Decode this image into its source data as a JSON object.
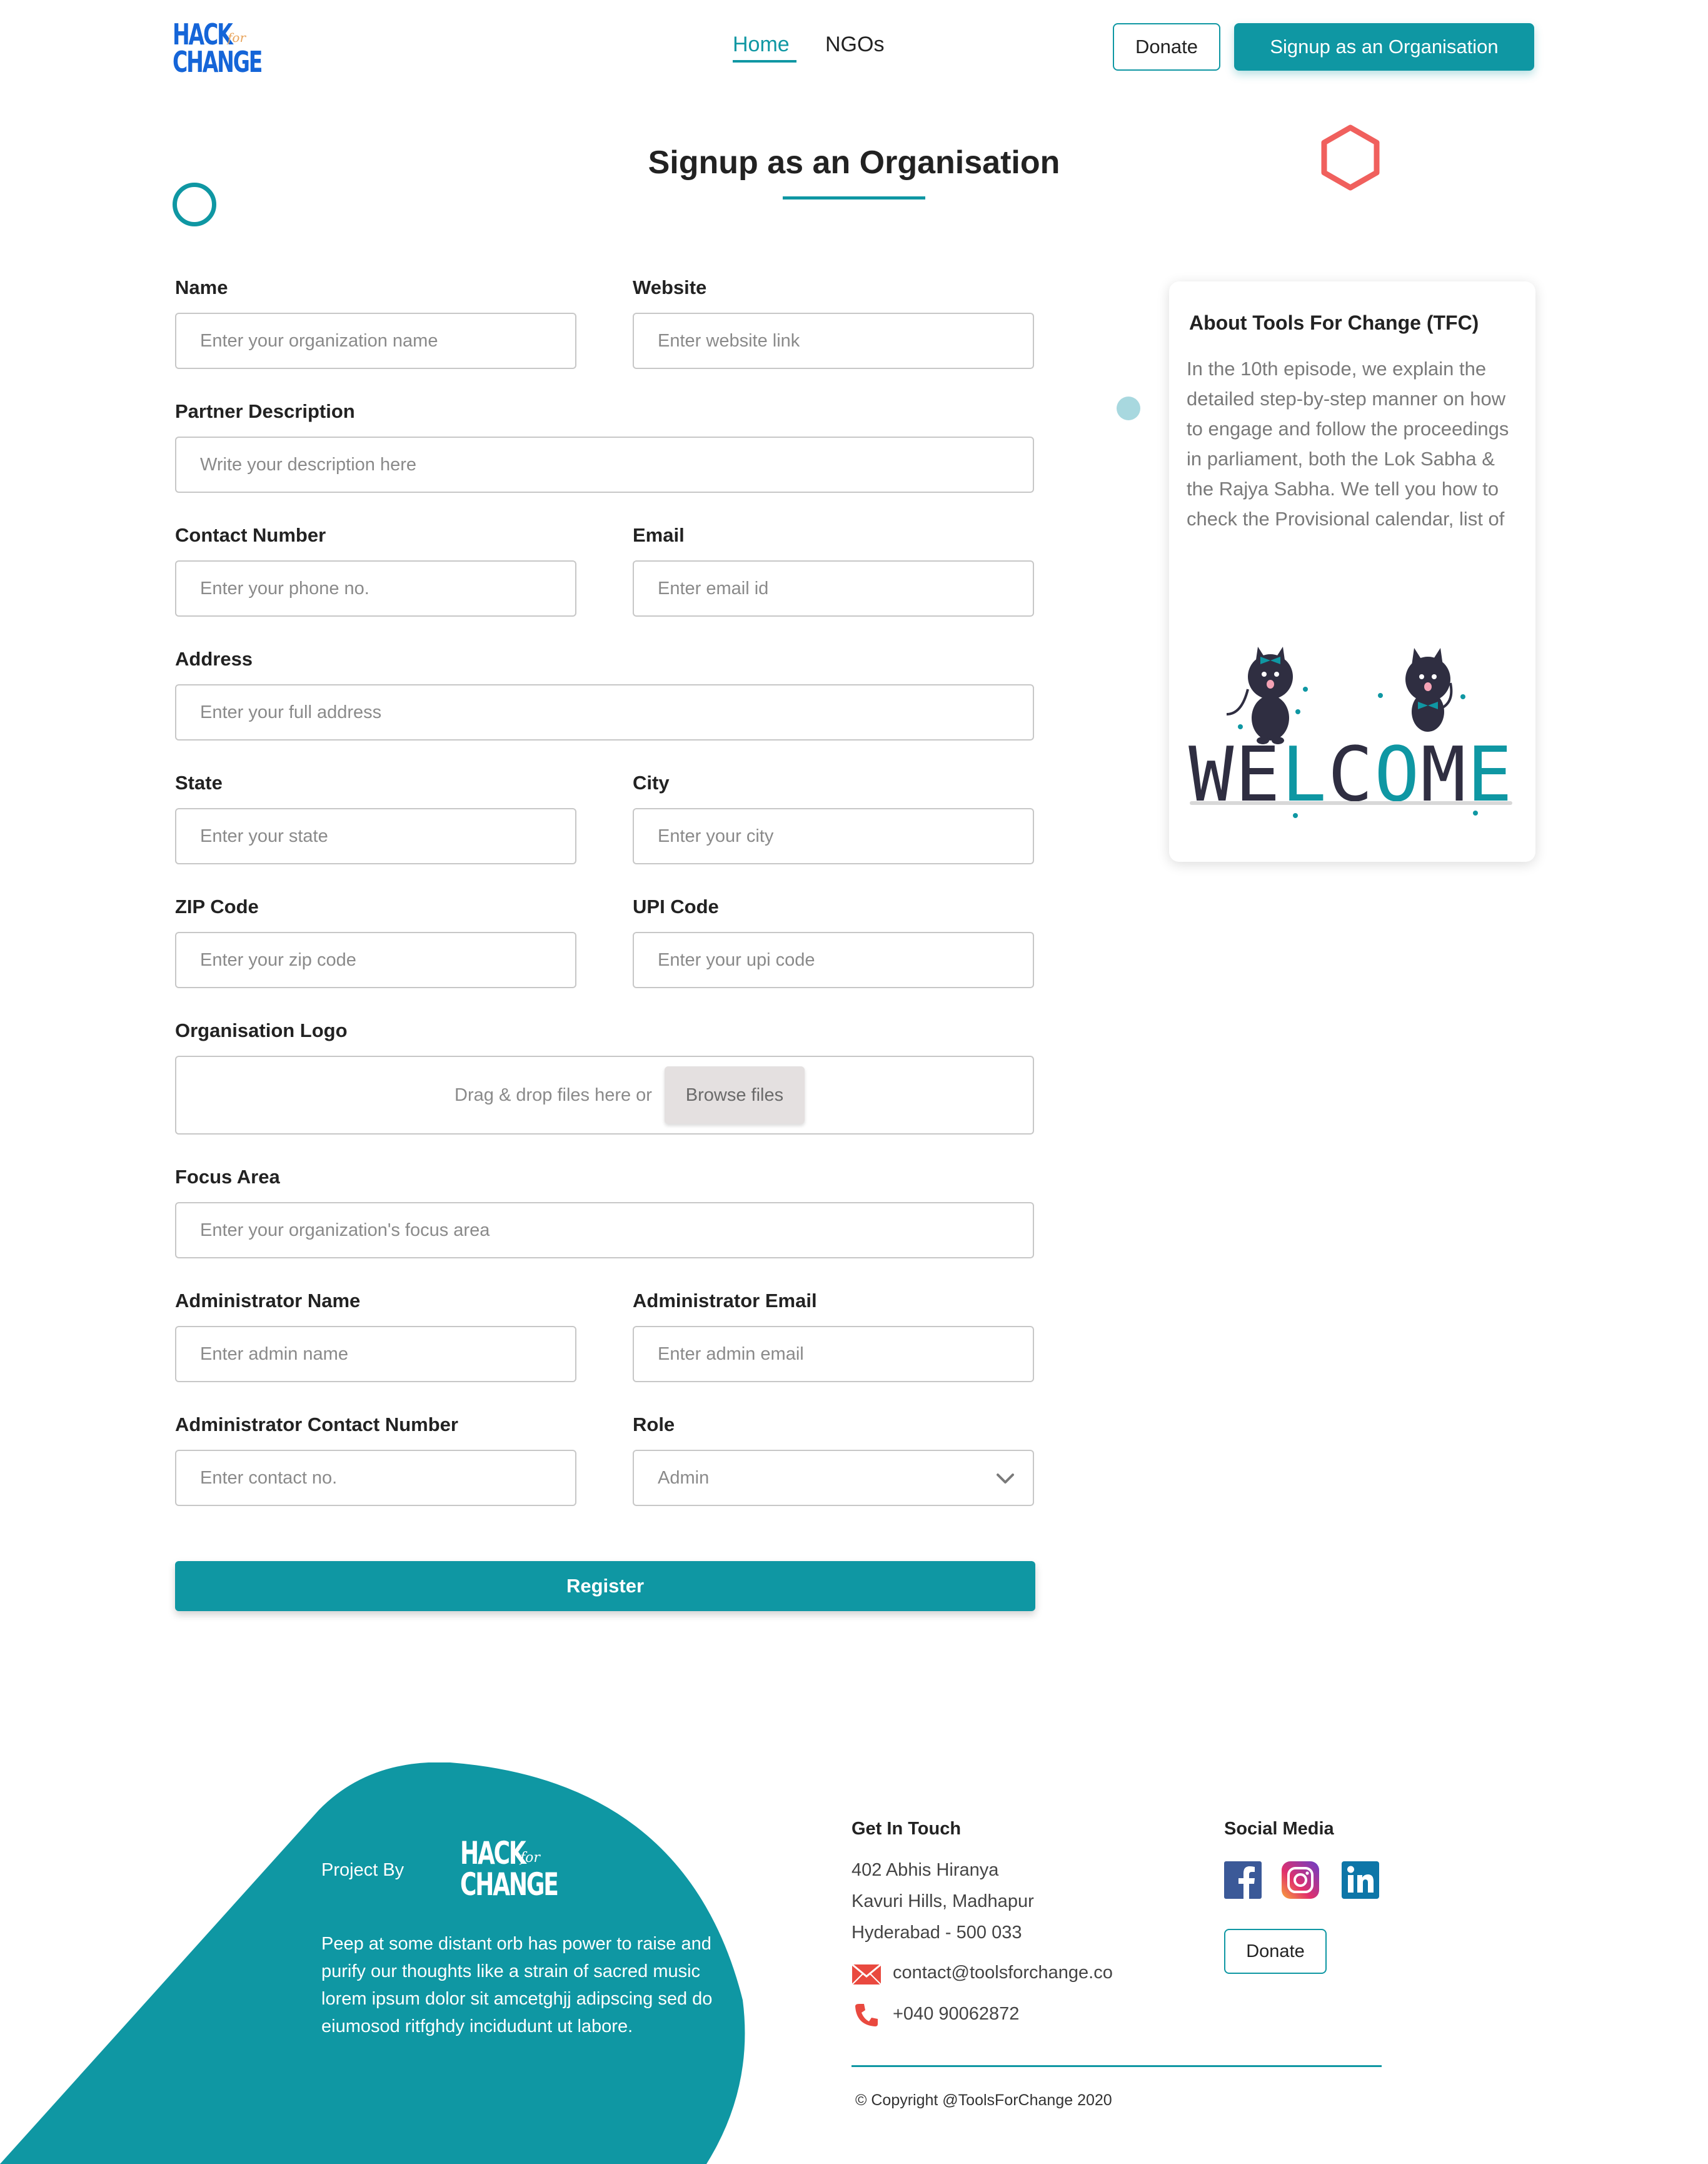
{
  "header": {
    "logo": {
      "line1": "HACK",
      "line2": "for",
      "line3": "CHANGE"
    },
    "nav": {
      "home": "Home",
      "ngos": "NGOs"
    },
    "donate_label": "Donate",
    "signup_label": "Signup as an Organisation"
  },
  "page_title": "Signup as an Organisation",
  "form": {
    "name": {
      "label": "Name",
      "placeholder": "Enter your organization name"
    },
    "website": {
      "label": "Website",
      "placeholder": "Enter website link"
    },
    "description": {
      "label": "Partner Description",
      "placeholder": "Write your description here"
    },
    "contact": {
      "label": "Contact Number",
      "placeholder": "Enter your phone no."
    },
    "email": {
      "label": "Email",
      "placeholder": "Enter email id"
    },
    "address": {
      "label": "Address",
      "placeholder": "Enter your full address"
    },
    "state": {
      "label": "State",
      "placeholder": "Enter your state"
    },
    "city": {
      "label": "City",
      "placeholder": "Enter your city"
    },
    "zip": {
      "label": "ZIP Code",
      "placeholder": "Enter your zip code"
    },
    "upi": {
      "label": "UPI Code",
      "placeholder": "Enter your upi code"
    },
    "logo": {
      "label": "Organisation Logo",
      "drop_text": "Drag & drop files here or",
      "browse_label": "Browse files"
    },
    "focus": {
      "label": "Focus Area",
      "placeholder": "Enter your organization's focus area"
    },
    "admin_name": {
      "label": "Administrator Name",
      "placeholder": "Enter admin name"
    },
    "admin_email": {
      "label": "Administrator Email",
      "placeholder": "Enter admin email"
    },
    "admin_contact": {
      "label": "Administrator Contact Number",
      "placeholder": "Enter contact no."
    },
    "role": {
      "label": "Role",
      "selected": "Admin"
    },
    "register_label": "Register"
  },
  "about": {
    "title": "About Tools For Change (TFC)",
    "text": "In the 10th episode, we explain the detailed step-by-step manner on how to engage and follow the proceedings in parliament, both the Lok Sabha & the Rajya Sabha. We tell you how to check the Provisional calendar, list of",
    "illustration_text": "WELCOME"
  },
  "footer": {
    "project_by": "Project By",
    "logo": {
      "line1": "HACK",
      "line2": "for",
      "line3": "CHANGE"
    },
    "description": "Peep at some distant orb has power to raise and purify our thoughts like a strain of sacred music lorem ipsum dolor sit amcetghjj adipscing sed do eiumosod ritfghdy incidudunt ut labore.",
    "get_in_touch": {
      "heading": "Get In Touch",
      "address_lines": [
        "402 Abhis Hiranya",
        "Kavuri Hills, Madhapur",
        "Hyderabad - 500 033"
      ],
      "email": "contact@toolsforchange.co",
      "phone": "+040  90062872"
    },
    "social": {
      "heading": "Social Media",
      "icons": [
        "facebook-icon",
        "instagram-icon",
        "linkedin-icon"
      ],
      "donate_label": "Donate"
    },
    "copyright": "© Copyright @ToolsForChange 2020"
  },
  "colors": {
    "accent": "#0f97a3",
    "logo_blue": "#1565d8",
    "hexagon": "#f0605d",
    "dot": "#a8d8df"
  }
}
